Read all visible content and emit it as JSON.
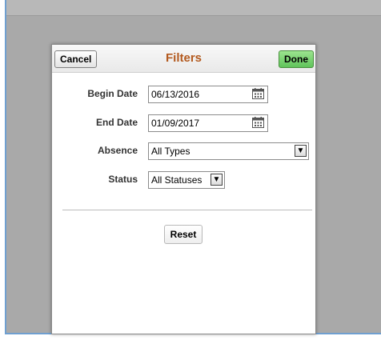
{
  "header": {
    "cancel_label": "Cancel",
    "title": "Filters",
    "done_label": "Done"
  },
  "fields": {
    "begin_date": {
      "label": "Begin Date",
      "value": "06/13/2016",
      "icon": "calendar-icon"
    },
    "end_date": {
      "label": "End Date",
      "value": "01/09/2017",
      "icon": "calendar-icon"
    },
    "absence": {
      "label": "Absence",
      "value": "All Types"
    },
    "status": {
      "label": "Status",
      "value": "All Statuses"
    }
  },
  "reset_label": "Reset",
  "colors": {
    "title": "#b35a1f",
    "done": "#5fc45a",
    "overlay": "#a9a9a9"
  }
}
